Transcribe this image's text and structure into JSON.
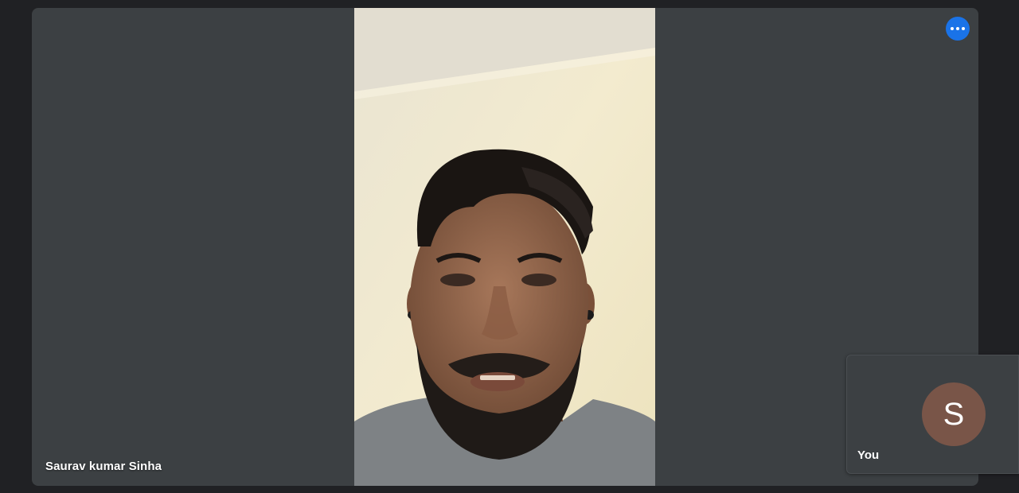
{
  "participant": {
    "name": "Saurav kumar Sinha"
  },
  "self_tile": {
    "avatar_initial": "S",
    "label": "You"
  },
  "controls": {
    "more_options_icon": "more-horiz-icon"
  },
  "colors": {
    "background": "#202124",
    "tile": "#3c4043",
    "accent": "#1a73e8",
    "avatar": "#795548"
  }
}
